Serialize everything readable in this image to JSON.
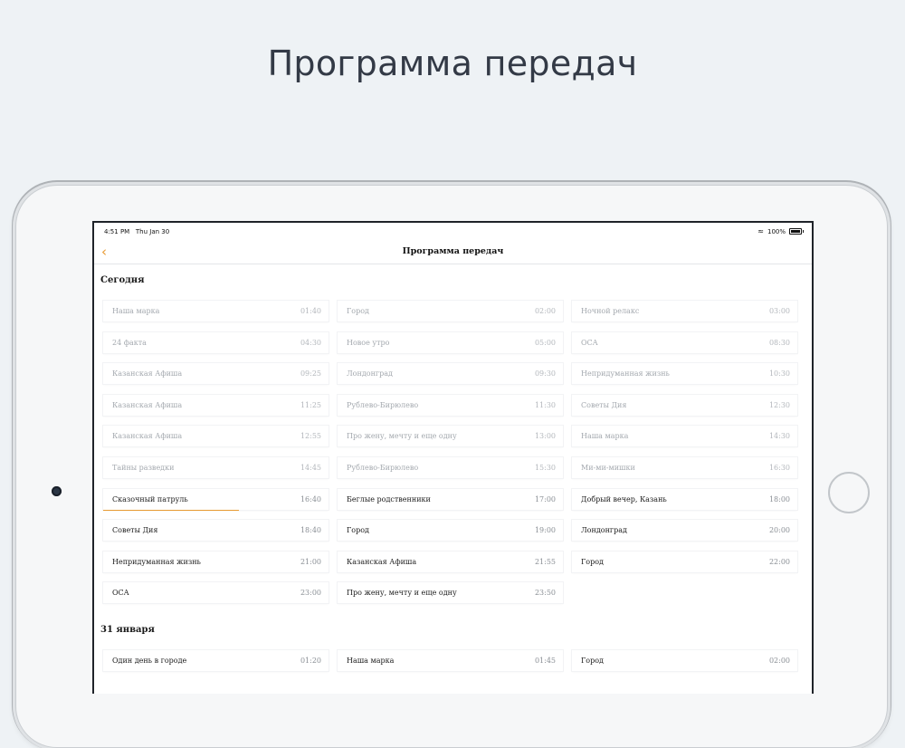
{
  "headline": "Программа передач",
  "status_bar": {
    "time": "4:51 PM",
    "date": "Thu Jan 30",
    "battery": "100%"
  },
  "nav": {
    "back_icon": "chevron-left-icon",
    "title": "Программа передач"
  },
  "accent_color": "#e89a32",
  "sections": [
    {
      "title": "Сегодня",
      "programs": [
        {
          "name": "Наша марка",
          "time": "01:40",
          "state": "past"
        },
        {
          "name": "Город",
          "time": "02:00",
          "state": "past"
        },
        {
          "name": "Ночной релакс",
          "time": "03:00",
          "state": "past"
        },
        {
          "name": "24 факта",
          "time": "04:30",
          "state": "past"
        },
        {
          "name": "Новое утро",
          "time": "05:00",
          "state": "past"
        },
        {
          "name": "ОСА",
          "time": "08:30",
          "state": "past"
        },
        {
          "name": "Казанская Афиша",
          "time": "09:25",
          "state": "past"
        },
        {
          "name": "Лондонград",
          "time": "09:30",
          "state": "past"
        },
        {
          "name": "Непридуманная жизнь",
          "time": "10:30",
          "state": "past"
        },
        {
          "name": "Казанская Афиша",
          "time": "11:25",
          "state": "past"
        },
        {
          "name": "Рублево-Бирюлево",
          "time": "11:30",
          "state": "past"
        },
        {
          "name": "Советы Дия",
          "time": "12:30",
          "state": "past"
        },
        {
          "name": "Казанская Афиша",
          "time": "12:55",
          "state": "past"
        },
        {
          "name": "Про жену, мечту и еще одну",
          "time": "13:00",
          "state": "past"
        },
        {
          "name": "Наша марка",
          "time": "14:30",
          "state": "past"
        },
        {
          "name": "Тайны разведки",
          "time": "14:45",
          "state": "past"
        },
        {
          "name": "Рублево-Бирюлево",
          "time": "15:30",
          "state": "past"
        },
        {
          "name": "Ми-ми-мишки",
          "time": "16:30",
          "state": "past"
        },
        {
          "name": "Сказочный патруль",
          "time": "16:40",
          "state": "live"
        },
        {
          "name": "Беглые родственники",
          "time": "17:00",
          "state": "upcoming"
        },
        {
          "name": "Добрый вечер, Казань",
          "time": "18:00",
          "state": "upcoming"
        },
        {
          "name": "Советы Дия",
          "time": "18:40",
          "state": "upcoming"
        },
        {
          "name": "Город",
          "time": "19:00",
          "state": "upcoming"
        },
        {
          "name": "Лондонград",
          "time": "20:00",
          "state": "upcoming"
        },
        {
          "name": "Непридуманная жизнь",
          "time": "21:00",
          "state": "upcoming"
        },
        {
          "name": "Казанская Афиша",
          "time": "21:55",
          "state": "upcoming"
        },
        {
          "name": "Город",
          "time": "22:00",
          "state": "upcoming"
        },
        {
          "name": "ОСА",
          "time": "23:00",
          "state": "upcoming"
        },
        {
          "name": "Про жену, мечту и еще одну",
          "time": "23:50",
          "state": "upcoming"
        }
      ]
    },
    {
      "title": "31 января",
      "programs": [
        {
          "name": "Один день в городе",
          "time": "01:20",
          "state": "upcoming"
        },
        {
          "name": "Наша марка",
          "time": "01:45",
          "state": "upcoming"
        },
        {
          "name": "Город",
          "time": "02:00",
          "state": "upcoming"
        }
      ]
    }
  ]
}
